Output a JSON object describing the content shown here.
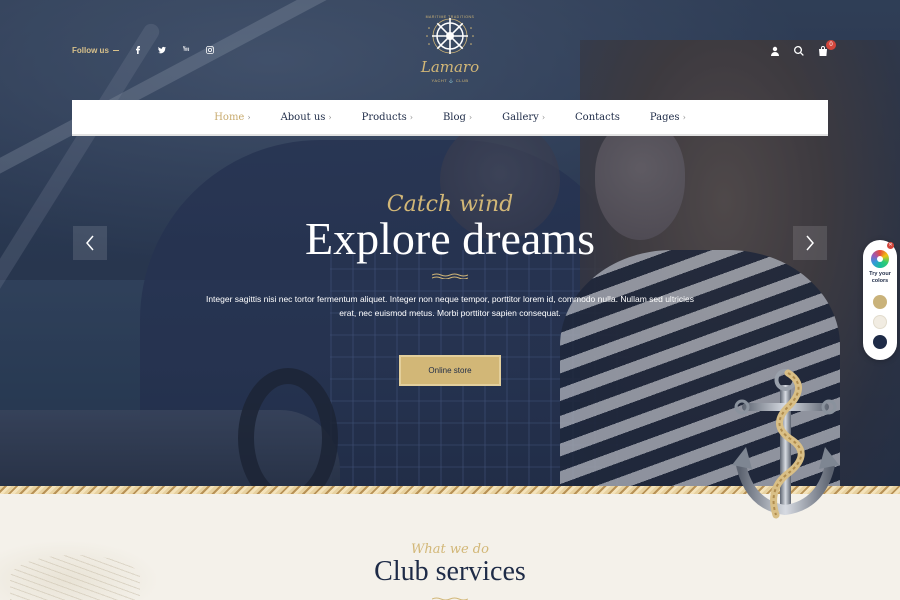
{
  "social": {
    "follow_label": "Follow us",
    "icons": [
      "facebook-icon",
      "twitter-icon",
      "youtube-icon",
      "instagram-icon"
    ]
  },
  "logo": {
    "top_text": "MARITIME TRADITIONS",
    "name": "Lamaro",
    "bottom_text": "YACHT ⚓ CLUB"
  },
  "header_icons": {
    "cart_count": "0"
  },
  "nav": {
    "items": [
      {
        "label": "Home",
        "caret": "›"
      },
      {
        "label": "About us",
        "caret": "›"
      },
      {
        "label": "Products",
        "caret": "›"
      },
      {
        "label": "Blog",
        "caret": "›"
      },
      {
        "label": "Gallery",
        "caret": "›"
      },
      {
        "label": "Contacts",
        "caret": ""
      },
      {
        "label": "Pages",
        "caret": "›"
      }
    ],
    "active": "Home"
  },
  "hero": {
    "kicker": "Catch wind",
    "title": "Explore dreams",
    "description": "Integer sagittis nisi nec tortor fermentum aliquet. Integer non neque tempor, porttitor lorem id, commodo nulla. Nullam sed ultricies erat, nec euismod metus. Morbi porttitor sapien consequat.",
    "cta_label": "Online store"
  },
  "color_panel": {
    "label": "Try your colors",
    "swatches": [
      "#c9b27a",
      "#f1ece2",
      "#1e2b47"
    ]
  },
  "services": {
    "kicker": "What we do",
    "title": "Club services"
  },
  "colors": {
    "accent": "#d2b777",
    "navy": "#1e2b47",
    "badge": "#d2453b"
  }
}
